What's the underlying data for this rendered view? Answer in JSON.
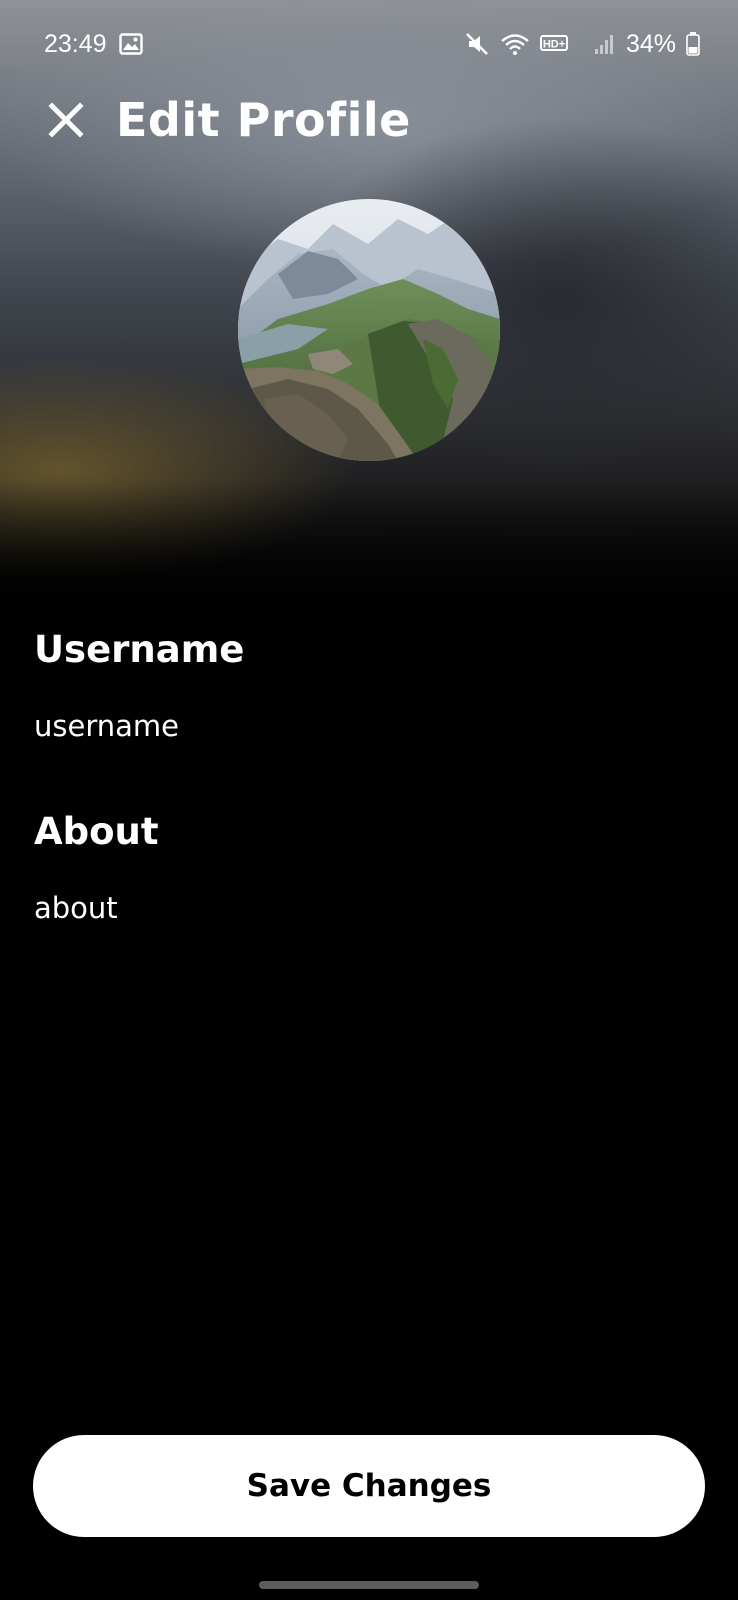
{
  "status_bar": {
    "time": "23:49",
    "battery": "34%",
    "network_label": "HD+",
    "icons": [
      "gallery-icon",
      "mute-icon",
      "wifi-icon",
      "hd-plus-icon",
      "signal-icon",
      "battery-icon"
    ]
  },
  "header": {
    "title": "Edit Profile",
    "close_icon": "close-icon"
  },
  "avatar": {
    "image": "mountain-landscape"
  },
  "form": {
    "username": {
      "label": "Username",
      "value": "username"
    },
    "about": {
      "label": "About",
      "value": "about"
    }
  },
  "actions": {
    "save_label": "Save Changes"
  },
  "colors": {
    "background": "#000000",
    "button_bg": "#ffffff",
    "button_text": "#000000",
    "text": "#ffffff"
  }
}
